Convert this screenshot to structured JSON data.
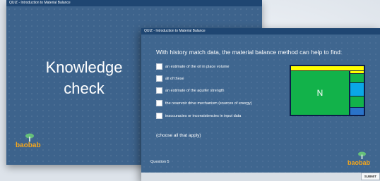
{
  "back_slide": {
    "title": "QUIZ - Introduction to Material Balance",
    "heading_line1": "Knowledge",
    "heading_line2": "check",
    "logo_text": "baobab"
  },
  "front_slide": {
    "title": "QUIZ - Introduction to Material Balance",
    "question": "With history match data, the material balance method can help to find:",
    "options": [
      {
        "label": "an estimate of the oil in place volume",
        "checked": false
      },
      {
        "label": "all of these",
        "checked": false
      },
      {
        "label": "an estimate of the aquifer strength",
        "checked": false
      },
      {
        "label": "the reservoir drive mechanism (sources of energy)",
        "checked": false
      },
      {
        "label": "inaccuracies or inconsistencies in input data",
        "checked": false
      }
    ],
    "hint": "(choose all that apply)",
    "question_number": "Question 5",
    "logo_text": "baobab",
    "submit_label": "SUBMIT"
  },
  "diagram": {
    "center_label": "N",
    "colors": {
      "frame": "#0b1d4a",
      "green": "#12b24a",
      "yellow": "#ffff00",
      "cyan": "#0aa7e6",
      "blue": "#2a73c9"
    }
  },
  "colors": {
    "slide_bg": "#3d638c",
    "titlebar": "#1f4672",
    "logo_orange": "#f4a61d"
  }
}
